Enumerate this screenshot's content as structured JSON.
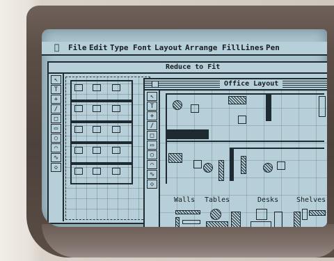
{
  "menubar": {
    "apple_icon": "apple-icon",
    "items": [
      "File",
      "Edit",
      "Type",
      "Font",
      "Layout",
      "Arrange",
      "Fill",
      "Lines",
      "Pen"
    ]
  },
  "back_window": {
    "title": "Reduce to Fit"
  },
  "front_window": {
    "title": "Office Layout"
  },
  "palette_labels": [
    "Walls",
    "Tables",
    "Desks",
    "Shelves"
  ],
  "tools": [
    "arrow",
    "T",
    "+",
    "/",
    "□",
    "▭",
    "○",
    "⌒",
    "∿",
    "◇"
  ]
}
